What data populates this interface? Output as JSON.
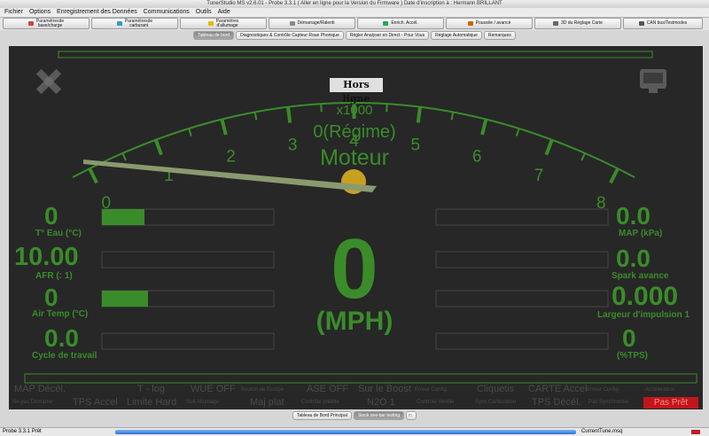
{
  "window": {
    "title": "TunerStudio MS v2.6.01 - Probe 3.3.1 ( Aller en ligne pour la Version du Firmware ) Date d'inscription à : Hermann BRILLANT"
  },
  "menu": [
    "Fichier",
    "Options",
    "Enregistrement des Données",
    "Communications",
    "Outils",
    "Aide"
  ],
  "toolbar": [
    {
      "line1": "Paramètresde",
      "line2": "base/charge",
      "icon": "gauge-icon",
      "color": "#c44"
    },
    {
      "line1": "Paramètresde",
      "line2": "carburant",
      "icon": "fuel-icon",
      "color": "#39c"
    },
    {
      "line1": "Paramètres",
      "line2": "d'allumage",
      "icon": "spark-icon",
      "color": "#e6b800"
    },
    {
      "line1": "Démarrage/Ralenti",
      "line2": "",
      "icon": "start-icon",
      "color": "#888"
    },
    {
      "line1": "Enrich. Accél.",
      "line2": "",
      "icon": "accel-icon",
      "color": "#2a5"
    },
    {
      "line1": "Poussée / avancé",
      "line2": "",
      "icon": "boost-icon",
      "color": "#c60"
    },
    {
      "line1": "3D du Réglage Carte",
      "line2": "",
      "icon": "map3d-icon",
      "color": "#666"
    },
    {
      "line1": "CAN bus/Testmodes",
      "line2": "",
      "icon": "can-icon",
      "color": "#555"
    }
  ],
  "tabs_top": [
    {
      "label": "Tableau de bord",
      "selected": true
    },
    {
      "label": "Diagnostiques & Contrôle Capteur Roue Phonique",
      "selected": false
    },
    {
      "label": "Régler Analyser en Direct - Pour Vous",
      "selected": false
    },
    {
      "label": "Réglage Automatique",
      "selected": false
    },
    {
      "label": "Remarques",
      "selected": false
    }
  ],
  "tach": {
    "ticks": [
      "0",
      "1",
      "2",
      "3",
      "4",
      "5",
      "6",
      "7",
      "8"
    ],
    "offline": "Hors ligne",
    "mult": "x1000",
    "reading": "0(Régime)",
    "name": "Moteur"
  },
  "left_gauges": [
    {
      "value": "0",
      "label": "T° Eau (°C)",
      "fill": 0.25
    },
    {
      "value": "10.00",
      "label": "AFR (: 1)",
      "fill": 0
    },
    {
      "value": "0",
      "label": "Air Temp (°C)",
      "fill": 0.25
    },
    {
      "value": "0.0",
      "label": "Cycle de travail",
      "fill": 0
    }
  ],
  "right_gauges": [
    {
      "value": "0.0",
      "label": "MAP (kPa)",
      "fill": 0
    },
    {
      "value": "0.0",
      "label": "Spark avance",
      "fill": 0
    },
    {
      "value": "0.000",
      "label": "Largeur d'impulsion 1",
      "fill": 0
    },
    {
      "value": "0",
      "label": "(%TPS)",
      "fill": 0
    }
  ],
  "speed": {
    "value": "0",
    "unit": "(MPH)"
  },
  "indicators": {
    "row1": [
      "MAP Décél.",
      "T - log",
      "WUE OFF",
      "Bouton de Ecorpe",
      "ASE OFF",
      "Sur le Boost",
      "Erreur Config.",
      "Cliquetis",
      "CARTE Accel",
      "Erreur Config.",
      "Acceleration"
    ],
    "row2": [
      "Ne pas Démarrer",
      "TPS Accel",
      "Limite Hard",
      "Soft Allumage",
      "Maj plat",
      "Contrôle prédite",
      "N2O 1",
      "Contrôle Ventilé",
      "Sync Carburation",
      "TPS Décél.",
      "Pas Synchronisé"
    ],
    "not_ready": "Pas Prêt"
  },
  "tabs_bottom": [
    {
      "label": "Tableau de Bord Principal",
      "selected": false
    },
    {
      "label": "Stock one-bar testing",
      "selected": true
    }
  ],
  "status": {
    "left": "Probe 3.3.1 Prêt",
    "file": "CurrentTune.msq"
  },
  "colors": {
    "green": "#3a8c2a",
    "dark": "#272727",
    "ghost": "#4b4b4b",
    "notready": "#c0161b"
  }
}
